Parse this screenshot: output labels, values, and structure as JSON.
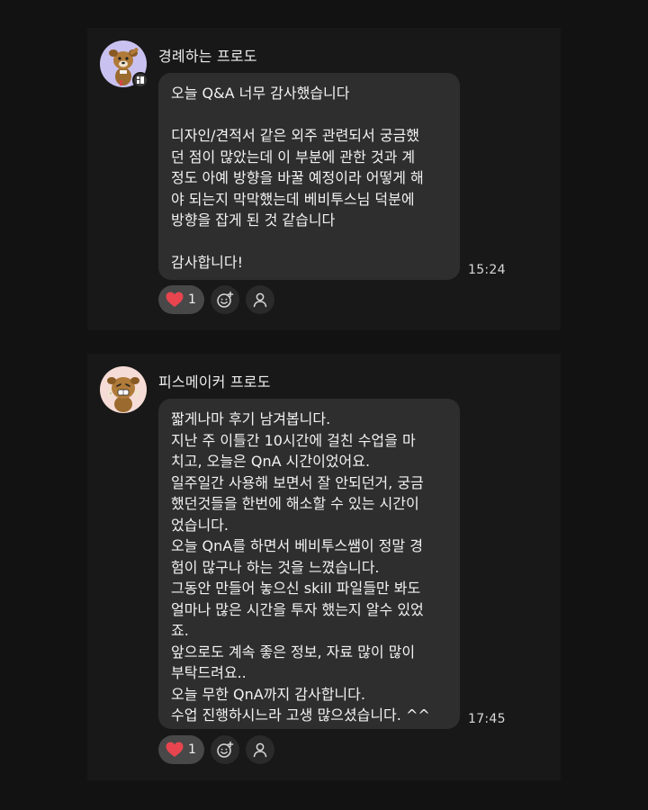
{
  "messages": [
    {
      "sender": "경례하는 프로도",
      "avatar_icon": "saluting-dog-character",
      "lines": [
        "오늘 Q&A 너무 감사했습니다",
        "",
        "디자인/견적서 같은 외주 관련되서 궁금했",
        "던 점이 많았는데 이 부분에 관한 것과 계",
        "정도 아예 방향을 바꿀 예정이라 어떻게 해",
        "야 되는지 막막했는데 베비투스님 덕분에",
        "방향을 잡게 된 것 같습니다",
        "",
        "감사합니다!"
      ],
      "time": "15:24",
      "reaction_count": "1"
    },
    {
      "sender": "피스메이커 프로도",
      "avatar_icon": "peace-sign-dog-character",
      "lines": [
        "짧게나마 후기 남겨봅니다.",
        "지난 주 이틀간 10시간에 걸친 수업을 마",
        "치고, 오늘은 QnA 시간이었어요.",
        "일주일간 사용해 보면서 잘 안되던거, 궁금",
        "했던것들을 한번에 해소할 수 있는 시간이",
        "었습니다.",
        "오늘 QnA를 하면서 베비투스쌤이 정말 경",
        "험이 많구나 하는 것을 느꼈습니다.",
        "그동안 만들어 놓으신 skill 파일들만 봐도",
        "얼마나 많은 시간을 투자 했는지 알수 있었",
        "죠.",
        "앞으로도 계속 좋은 정보, 자료 많이 많이",
        "부탁드려요..",
        "오늘 무한 QnA까지 감사합니다.",
        "수업 진행하시느라 고생 많으셨습니다. ^^"
      ],
      "time": "17:45",
      "reaction_count": "1"
    }
  ],
  "colors": {
    "background": "#121212",
    "card": "#181818",
    "bubble": "#2e2e2e",
    "reaction_pill": "#484848",
    "heart": "#e8454f"
  }
}
